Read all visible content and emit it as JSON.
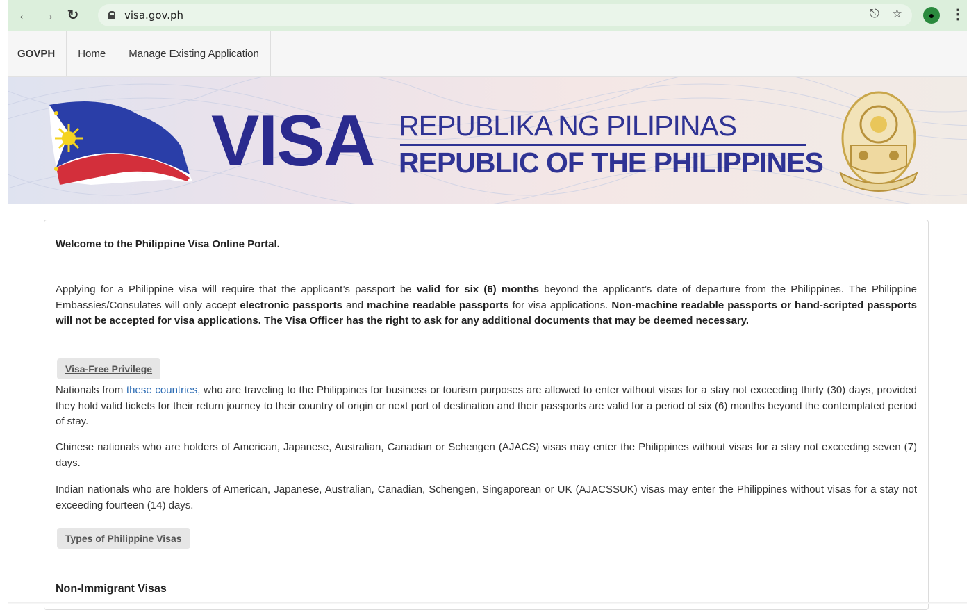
{
  "browser": {
    "url": "visa.gov.ph",
    "back_icon": "arrow-left-icon",
    "forward_icon": "arrow-right-icon",
    "reload_icon": "reload-icon",
    "lock_icon": "lock-icon",
    "share_icon": "share-icon",
    "star_icon": "star-icon",
    "profile_icon": "profile-icon",
    "menu_icon": "kebab-menu-icon"
  },
  "nav": {
    "brand": "GOVPH",
    "items": [
      {
        "label": "Home"
      },
      {
        "label": "Manage Existing Application"
      }
    ]
  },
  "banner": {
    "visa_word": "VISA",
    "title_tl": "REPUBLIKA NG PILIPINAS",
    "title_en": "REPUBLIC OF THE PHILIPPINES",
    "seal_text": "REPUBLIKA NG PILIPINAS"
  },
  "content": {
    "welcome": "Welcome to the Philippine Visa Online Portal.",
    "intro": {
      "t1": "Applying for a Philippine visa will require that the applicant’s passport be ",
      "b1": "valid for six (6) months",
      "t2": " beyond the applicant’s date of departure from the Philippines. The Philippine Embassies/Consulates will only accept ",
      "b2": "electronic passports",
      "t3": " and ",
      "b3": "machine readable passports",
      "t4": " for visa applications. ",
      "b4": "Non-machine readable passports or hand-scripted passports will not be accepted for visa applications. The Visa Officer has the right to ask for any additional documents that may be deemed necessary."
    },
    "visa_free_label": "Visa-Free Privilege",
    "nationals": {
      "t1": "Nationals from ",
      "link": "these countries,",
      "t2": " who are traveling to the Philippines for business or tourism purposes are allowed to enter without visas for a stay not exceeding thirty (30) days, provided they hold valid tickets for their return journey to their country of origin or next port of destination and their passports are valid for a period of six (6) months beyond the contemplated period of stay."
    },
    "chinese": "Chinese nationals who are holders of American, Japanese, Australian, Canadian or Schengen (AJACS) visas may enter the Philippines without visas for a stay not exceeding seven (7) days.",
    "indian": "Indian nationals who are holders of American, Japanese, Australian, Canadian, Schengen, Singaporean or UK (AJACSSUK) visas may enter the Philippines without visas for a stay not exceeding fourteen (14) days.",
    "types_label": "Types of Philippine Visas",
    "non_immigrant_title": "Non-Immigrant Visas"
  }
}
